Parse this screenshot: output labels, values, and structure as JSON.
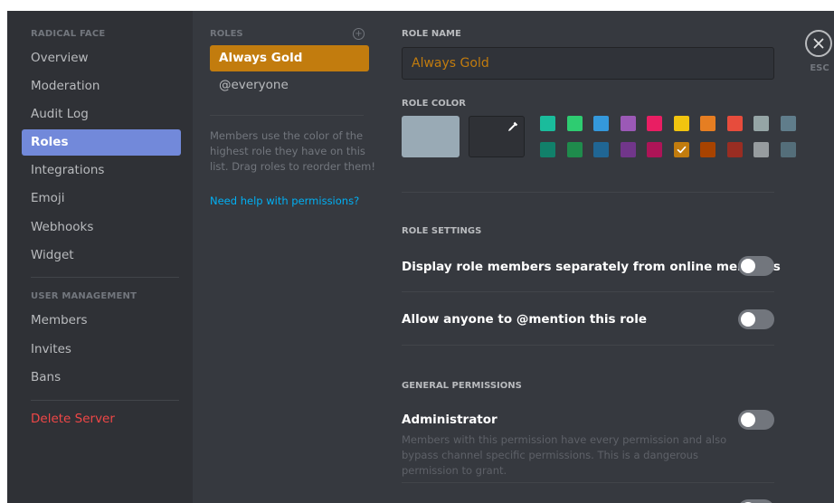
{
  "sidebar": {
    "server_name": "RADICAL FACE",
    "items": [
      "Overview",
      "Moderation",
      "Audit Log",
      "Roles",
      "Integrations",
      "Emoji",
      "Webhooks",
      "Widget"
    ],
    "active": "Roles",
    "user_management_header": "USER MANAGEMENT",
    "user_items": [
      "Members",
      "Invites",
      "Bans"
    ],
    "delete_label": "Delete Server"
  },
  "roles": {
    "header": "ROLES",
    "items": [
      {
        "label": "Always Gold",
        "selected": true,
        "color": "#c27c0e"
      },
      {
        "label": "@everyone",
        "selected": false
      }
    ],
    "help_text": "Members use the color of the highest role they have on this list. Drag roles to reorder them!",
    "help_link": "Need help with permissions?",
    "add_icon": "plus-circle-icon"
  },
  "role_name": {
    "label": "ROLE NAME",
    "value": "Always Gold"
  },
  "role_color": {
    "label": "ROLE COLOR",
    "default_color": "#99aab5",
    "picker_icon": "eyedropper-icon",
    "swatches_top": [
      "#1abc9c",
      "#2ecc71",
      "#3498db",
      "#9b59b6",
      "#e91e63",
      "#f1c40f",
      "#e67e22",
      "#e74c3c",
      "#95a5a6",
      "#607d8b"
    ],
    "swatches_bottom": [
      "#11806a",
      "#1f8b4c",
      "#206694",
      "#71368a",
      "#ad1457",
      "#c27c0e",
      "#a84300",
      "#992d22",
      "#979c9f",
      "#546e7a"
    ],
    "selected_swatch": "#c27c0e",
    "check_icon": "check-icon"
  },
  "role_settings": {
    "header": "ROLE SETTINGS",
    "items": [
      {
        "label": "Display role members separately from online members",
        "enabled": false
      },
      {
        "label": "Allow anyone to @mention this role",
        "enabled": false
      }
    ]
  },
  "general_permissions": {
    "header": "GENERAL PERMISSIONS",
    "items": [
      {
        "label": "Administrator",
        "description": "Members with this permission have every permission and also bypass channel specific permissions. This is a dangerous permission to grant.",
        "enabled": false
      }
    ]
  },
  "close": {
    "icon": "close-icon",
    "label": "ESC"
  }
}
